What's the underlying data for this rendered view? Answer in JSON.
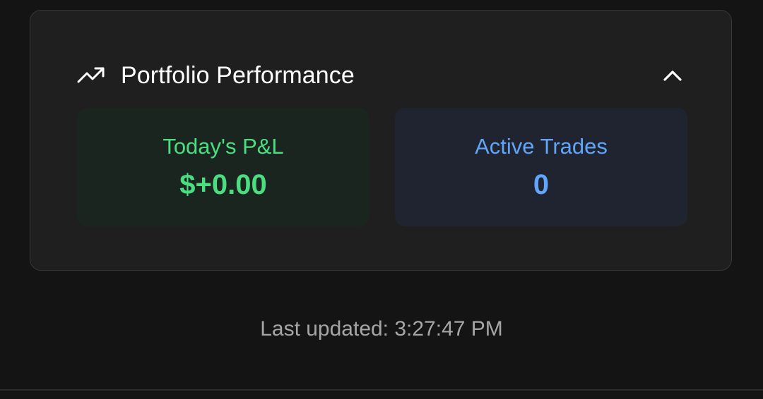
{
  "panel": {
    "title": "Portfolio Performance",
    "icon": "trending-up-icon",
    "collapse_icon": "chevron-up-icon"
  },
  "stats": {
    "pnl": {
      "label": "Today's P&L",
      "value": "$+0.00",
      "color": "#4ade80"
    },
    "trades": {
      "label": "Active Trades",
      "value": "0",
      "color": "#60a5fa"
    }
  },
  "footer": {
    "last_updated": "Last updated: 3:27:47 PM"
  },
  "colors": {
    "background": "#141414",
    "card": "#1f1f1f",
    "card_border": "#363636",
    "pnl_tile": "#1b251f",
    "trades_tile": "#1f2430",
    "muted_text": "#a6a6a6"
  }
}
